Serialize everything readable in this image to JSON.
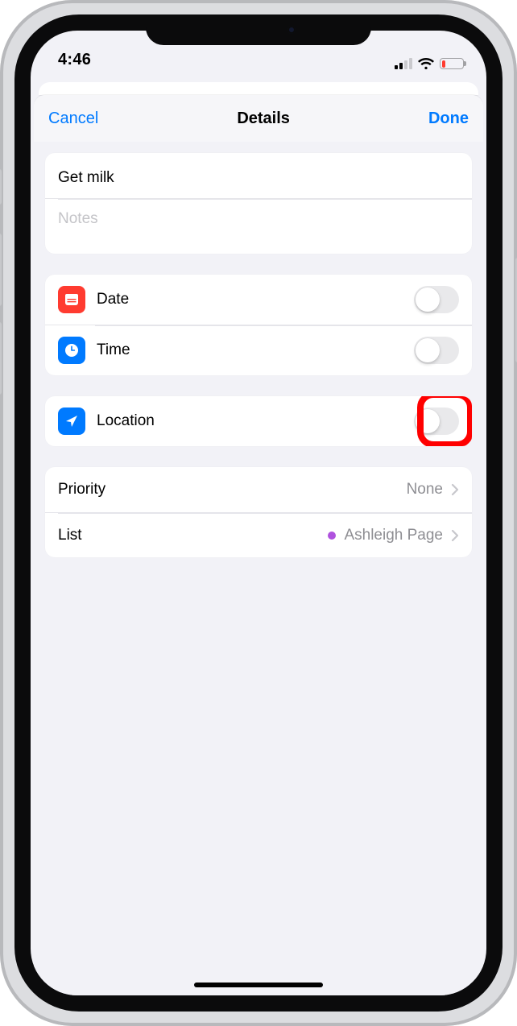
{
  "status": {
    "time": "4:46",
    "cell_active_bars": 2,
    "battery_low": true
  },
  "nav": {
    "cancel": "Cancel",
    "title": "Details",
    "done": "Done"
  },
  "reminder": {
    "title_value": "Get milk",
    "notes_placeholder": "Notes"
  },
  "rows": {
    "date": {
      "label": "Date",
      "on": false
    },
    "time": {
      "label": "Time",
      "on": false
    },
    "location": {
      "label": "Location",
      "on": false
    }
  },
  "meta": {
    "priority": {
      "label": "Priority",
      "value": "None"
    },
    "list": {
      "label": "List",
      "value": "Ashleigh Page",
      "dot_color": "#af52de"
    }
  },
  "annotation": {
    "highlight_target": "location-toggle"
  }
}
